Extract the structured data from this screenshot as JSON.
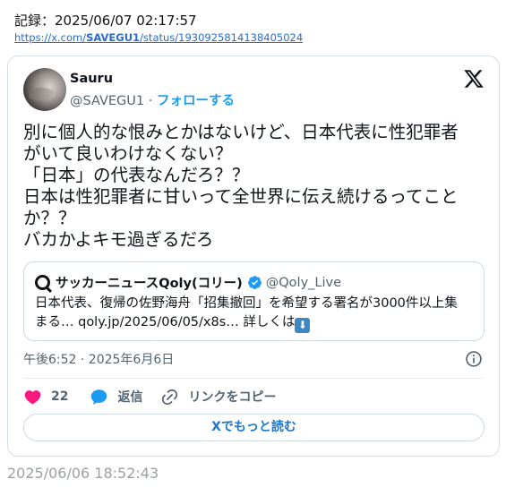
{
  "record": {
    "label": "記録：2025/06/07 02:17:57",
    "url_prefix": "https://x.com/",
    "url_user": "SAVEGU1",
    "url_suffix": "/status/1930925814138405024"
  },
  "tweet": {
    "author_name": "Sauru",
    "author_handle": "@SAVEGU1",
    "separator": " · ",
    "follow_label": "フォローする",
    "text_lines": [
      "別に個人的な恨みとかはないけど、日本代表に性犯罪者",
      "がいて良いわけなくない？",
      "「日本」の代表なんだろ？？",
      "日本は性犯罪者に甘いって全世界に伝え続けるってこと",
      "か？？",
      "バカかよキモ過ぎるだろ"
    ],
    "timestamp": "午後6:52 · 2025年6月6日",
    "likes": "22",
    "reply_label": "返信",
    "copy_link_label": "リンクをコピー",
    "read_more_label": "Xでもっと読む"
  },
  "quote": {
    "name": "サッカーニュースQoly(コリー)",
    "handle": "@Qoly_Live",
    "line1": "日本代表、復帰の佐野海舟「招集撤回」を希望する署名が3000件以上集",
    "line2": "まる… qoly.jp/2025/06/05/x8s… 詳しくは"
  },
  "footer": {
    "saved_at": "2025/06/06 18:52:43"
  },
  "colors": {
    "accent": "#1d9bf0",
    "like": "#f91880",
    "verified": "#1d9bf0",
    "muted": "#536471"
  },
  "icons": [
    "x-logo-icon",
    "verified-icon",
    "qoly-logo-icon",
    "info-icon",
    "heart-icon",
    "reply-icon",
    "link-icon",
    "down-arrow-emoji-icon"
  ]
}
